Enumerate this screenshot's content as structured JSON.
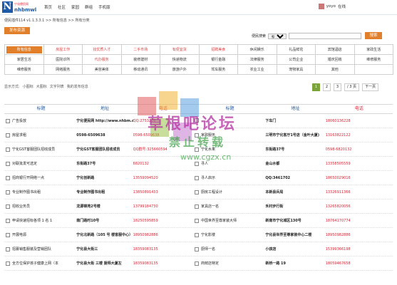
{
  "header": {
    "logo_text1": "宁化便民网",
    "logo_text2": "nhbmwl",
    "nav": [
      "首页",
      "社区",
      "家园",
      "群组",
      "手机版"
    ],
    "user": "yoyo",
    "user_status": "在线"
  },
  "breadcrumb": "便民插件114 v1.1.3.3.1 >> 所有信息 >> 所有分类",
  "publish_btn": "发布资源",
  "search": {
    "label": "便民搜索",
    "field": "标题",
    "button": "搜索"
  },
  "categories": [
    [
      "所有信息",
      "房屋工作",
      "找优质人才",
      "二手市场",
      "有便宜货",
      "招聘美食",
      "休闲娱乐",
      "礼品鲜花",
      "宾馆酒店",
      "家政生活"
    ],
    [
      "家居生活",
      "医院诊所",
      "代办服务",
      "装修建材",
      "快递物流",
      "银行金融",
      "法律服务",
      "公司企业",
      "婚庆回收",
      "维修服务"
    ],
    [
      "维修服务",
      "网络服务",
      "美容美体",
      "移动通讯",
      "旅游户外",
      "驾车服务",
      "农业工业",
      "宠物家具",
      "其他",
      ""
    ]
  ],
  "view": {
    "label": "显示方式:",
    "options": [
      "小图标",
      "大图标",
      "文字列表",
      "我的发布信息"
    ]
  },
  "pager": {
    "pages": [
      "1",
      "2",
      "3"
    ],
    "total": "/ 3 页",
    "next": "下一页"
  },
  "table": {
    "headers": [
      "标题",
      "地址",
      "电话",
      "标题",
      "地址",
      "电话"
    ],
    "rows": [
      [
        "广告投放",
        "宁化便民网 http://www.nhbm.cn",
        "QQ:2753226",
        "",
        "下车门",
        "18060136228"
      ],
      [
        "房屋求租",
        "0598-6509638",
        "0598-6509638",
        "家政服务",
        "三明市宁化客厅1号店（金叶大厦)",
        "13163822122"
      ],
      [
        "宁化GST客服团队招收成员",
        "宁化GST客服团队招收成员",
        "QQ群号:325660594",
        "宁化水果",
        "东街路37号",
        "0598-6820132"
      ],
      [
        "对联批发可选定",
        "东街路37号",
        "6820132",
        "寻人",
        "金山水都",
        "13358505559"
      ],
      [
        "招商银行开网络一点",
        "宁化创新路",
        "13559094520",
        "寻人启示",
        "QQ:3461702",
        "18650029016"
      ],
      [
        "专业制作图书出租",
        "专业制作图书出租",
        "13850891433",
        "厨房工程设计",
        "本新县兵局",
        "13326911366"
      ],
      [
        "招收业务员",
        "龙源锦苑2号楼",
        "13799184730",
        "家具店一名",
        "禾村步行街",
        "13265820056"
      ],
      [
        "申请快速招标各项 1 名 1",
        "南门路时10号",
        "18250595859",
        "中国世界至尊家装大师",
        "新南市宁化城区130号",
        "18764170774"
      ],
      [
        "开展电源",
        "宁化北新路（105 号 楼客服中心）",
        "18950982886",
        "宁化影楼",
        "宁化县世界至尊家装中心二楼",
        "18950982886"
      ],
      [
        "招募销售服装及营销团队",
        "宁化县大街三",
        "18359083135",
        "厨师一名",
        "小孩店",
        "15399366198"
      ],
      [
        "全方位保护孩子健康上网（本",
        "宁化县大街 三楼 厨师大厦左",
        "18359083135",
        "商鲜店特定",
        "新桥一路 19",
        "18059467658"
      ]
    ]
  },
  "watermark": {
    "line1": "草根吧论坛",
    "line2": "禁止转载",
    "line3": "www.cgzx.cn"
  }
}
